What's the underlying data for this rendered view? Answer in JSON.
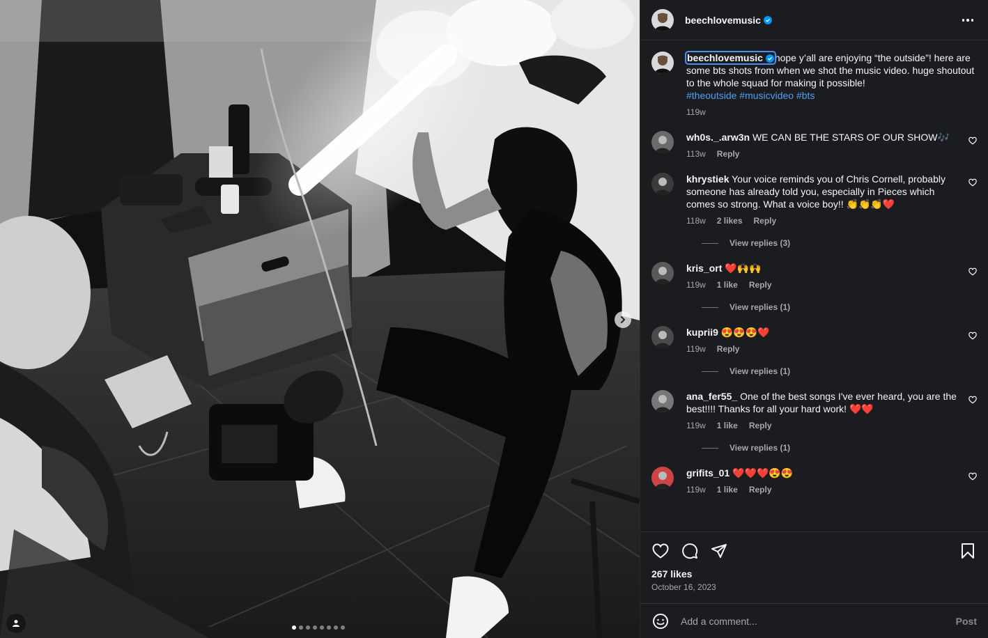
{
  "post": {
    "author": "beechlovemusic",
    "likes": "267 likes",
    "date": "October 16, 2023",
    "slide_count": 8,
    "active_slide": 1
  },
  "caption": {
    "username": "beechlovemusic",
    "text": "hope y’all are enjoying “the outside”! here are some bts shots from when we shot the music video. huge shoutout to the whole squad for making it possible!",
    "hashtags": "#theoutside #musicvideo #bts",
    "time": "119w"
  },
  "comments": [
    {
      "username": "wh0s._.arw3n",
      "text": "WE CAN BE THE STARS OF OUR SHOW🎶",
      "time": "113w",
      "likes": "",
      "reply": "Reply",
      "replies": ""
    },
    {
      "username": "khrystiek",
      "text": "Your voice reminds you of Chris Cornell, probably someone has already told you, especially in Pieces which comes so strong. What a voice boy!! 👏👏👏❤️",
      "time": "118w",
      "likes": "2 likes",
      "reply": "Reply",
      "replies": "View replies (3)"
    },
    {
      "username": "kris_ort",
      "text": "❤️🙌🙌",
      "time": "119w",
      "likes": "1 like",
      "reply": "Reply",
      "replies": "View replies (1)"
    },
    {
      "username": "kuprii9",
      "text": "😍😍😍❤️",
      "time": "119w",
      "likes": "",
      "reply": "Reply",
      "replies": "View replies (1)"
    },
    {
      "username": "ana_fer55_",
      "text": "One of the best songs I've ever heard, you are the best!!!! Thanks for all your hard work! ❤️❤️",
      "time": "119w",
      "likes": "1 like",
      "reply": "Reply",
      "replies": "View replies (1)"
    },
    {
      "username": "grifits_01",
      "text": "❤️❤️❤️😍😍",
      "time": "119w",
      "likes": "1 like",
      "reply": "Reply",
      "replies": ""
    }
  ],
  "composer": {
    "placeholder": "Add a comment...",
    "post_label": "Post"
  },
  "icons": {
    "like": "heart-icon",
    "comment": "comment-icon",
    "share": "share-icon",
    "save": "bookmark-icon",
    "emoji": "emoji-icon",
    "more": "more-icon",
    "next": "chevron-right-icon",
    "tags": "user-tag-icon"
  },
  "colors": {
    "panel_bg": "#1b1c20",
    "accent": "#0095f6",
    "hashtag": "#4f9ff7",
    "muted": "#a8a8a8"
  }
}
